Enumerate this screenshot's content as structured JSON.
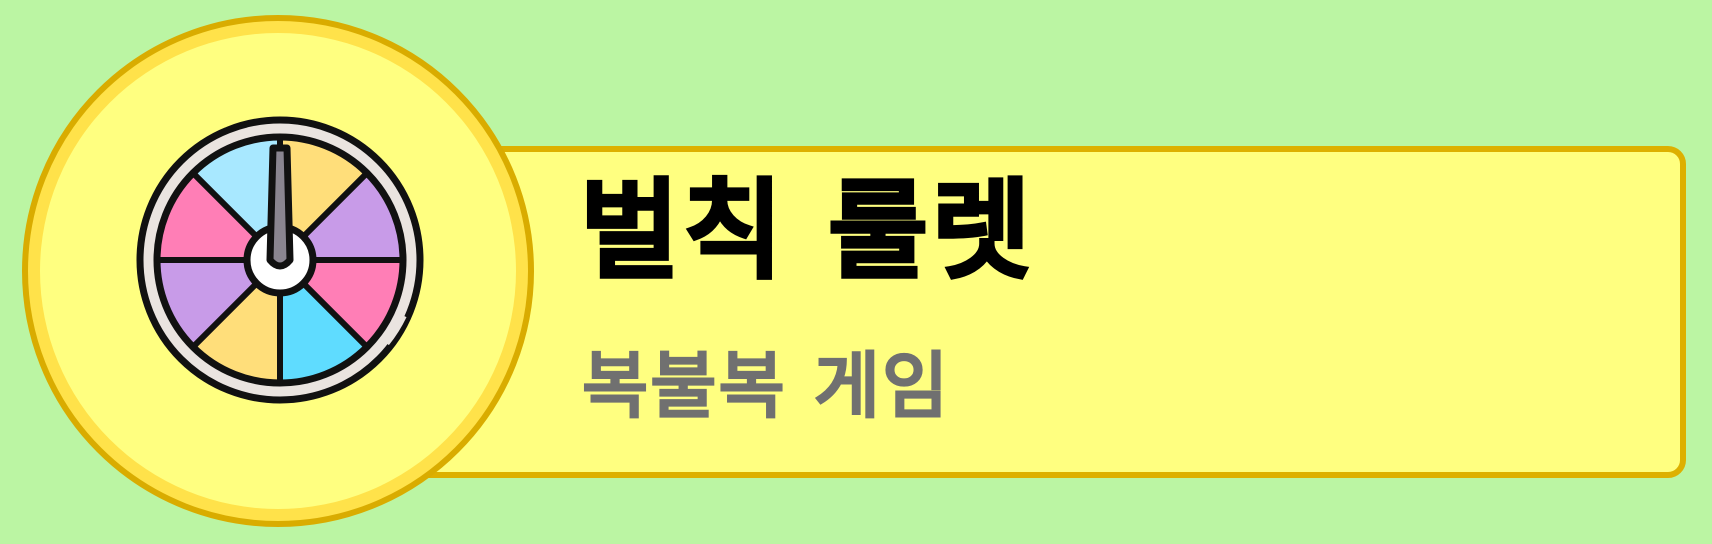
{
  "title": "벌칙 룰렛",
  "subtitle": "복불복 게임",
  "icon": {
    "name": "roulette-wheel-icon",
    "segment_colors": [
      "#ffde7a",
      "#c89be8",
      "#ff7eb6",
      "#5fdcff",
      "#ffde7a",
      "#c89be8",
      "#ff7eb6",
      "#a8e8ff"
    ]
  },
  "colors": {
    "background": "#bbf5a3",
    "banner_fill": "#ffff80",
    "banner_border": "#ddb000",
    "title_text": "#000000",
    "subtitle_text": "#707070"
  }
}
